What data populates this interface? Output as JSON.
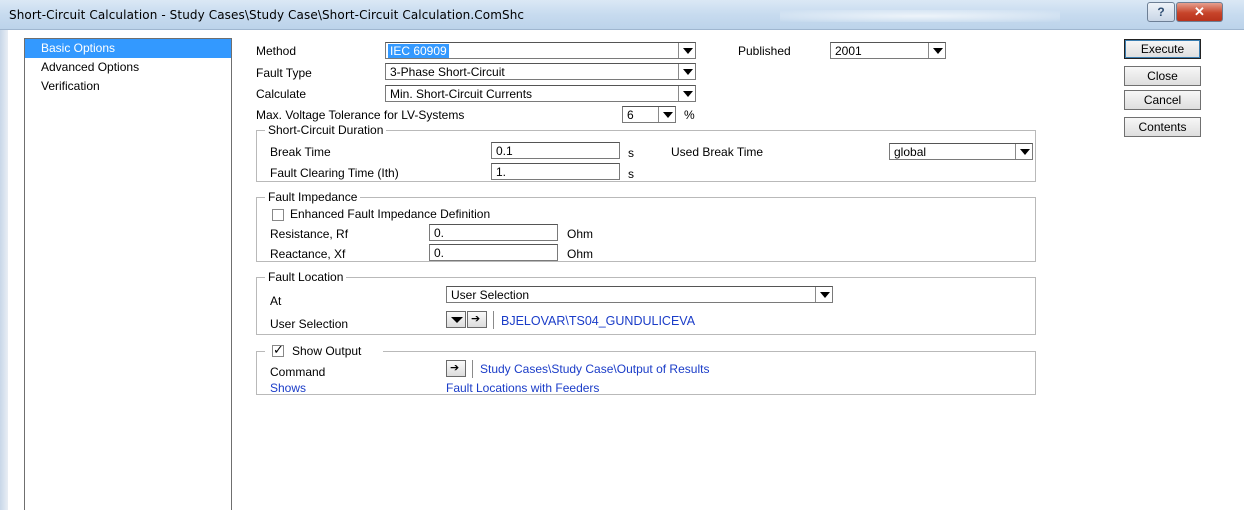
{
  "window": {
    "title": "Short-Circuit Calculation - Study Cases\\Study Case\\Short-Circuit Calculation.ComShc",
    "help_glyph": "?",
    "close_glyph": "✕"
  },
  "nav": {
    "items": [
      {
        "label": "Basic Options",
        "selected": true
      },
      {
        "label": "Advanced Options",
        "selected": false
      },
      {
        "label": "Verification",
        "selected": false
      }
    ]
  },
  "form": {
    "method_label": "Method",
    "method_value": "IEC 60909",
    "published_label": "Published",
    "published_value": "2001",
    "fault_type_label": "Fault Type",
    "fault_type_value": "3-Phase Short-Circuit",
    "calculate_label": "Calculate",
    "calculate_value": "Min. Short-Circuit Currents",
    "max_voltage_label": "Max. Voltage Tolerance for LV-Systems",
    "max_voltage_value": "6",
    "max_voltage_unit": "%"
  },
  "duration": {
    "group_title": "Short-Circuit Duration",
    "break_time_label": "Break Time",
    "break_time_value": "0.1",
    "break_time_unit": "s",
    "used_break_label": "Used Break Time",
    "used_break_value": "global",
    "clearing_label": "Fault Clearing Time (Ith)",
    "clearing_value": "1.",
    "clearing_unit": "s"
  },
  "impedance": {
    "group_title": "Fault Impedance",
    "enhanced_label": "Enhanced Fault Impedance Definition",
    "enhanced_checked": false,
    "resistance_label": "Resistance, Rf",
    "resistance_value": "0.",
    "resistance_unit": "Ohm",
    "reactance_label": "Reactance, Xf",
    "reactance_value": "0.",
    "reactance_unit": "Ohm"
  },
  "location": {
    "group_title": "Fault Location",
    "at_label": "At",
    "at_value": "User Selection",
    "user_selection_label": "User Selection",
    "user_selection_value": "BJELOVAR\\TS04_GUNDULICEVA"
  },
  "output": {
    "show_output_label": "Show Output",
    "show_output_checked": true,
    "command_label": "Command",
    "command_value": "Study Cases\\Study Case\\Output of Results",
    "shows_label": "Shows",
    "shows_value": "Fault Locations with Feeders"
  },
  "buttons": {
    "execute": "Execute",
    "close": "Close",
    "cancel": "Cancel",
    "contents": "Contents"
  },
  "colors": {
    "selection": "#3399ff",
    "link_blue": "#1a3cc8"
  }
}
